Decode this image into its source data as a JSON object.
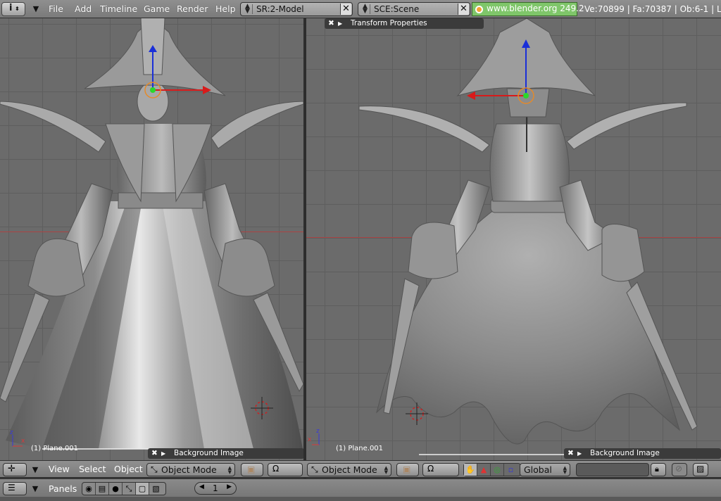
{
  "topbar": {
    "menus": [
      "File",
      "Add",
      "Timeline",
      "Game",
      "Render",
      "Help"
    ],
    "screen_field": "SR:2-Model",
    "scene_field": "SCE:Scene",
    "url": "www.blender.org 249.2",
    "stats": "Ve:70899 | Fa:70387 | Ob:6-1 | L"
  },
  "viewport_left": {
    "object_label": "(1) Plane.001"
  },
  "viewport_right": {
    "object_label": "(1) Plane.001",
    "transform_panel": "Transform Properties"
  },
  "panels": {
    "bg_image_left": "Background Image",
    "bg_image_right": "Background Image"
  },
  "header3d": {
    "menus": [
      "View",
      "Select",
      "Object"
    ],
    "mode_left": "Object Mode",
    "mode_right": "Object Mode",
    "orientation": "Global"
  },
  "panelsbar": {
    "label": "Panels",
    "frame": "1"
  },
  "icons": [
    "info-icon",
    "chevron-down-icon",
    "close-icon",
    "globe-icon",
    "hand-icon",
    "snap-icon",
    "render-icon",
    "image-icon",
    "panel-icon"
  ]
}
